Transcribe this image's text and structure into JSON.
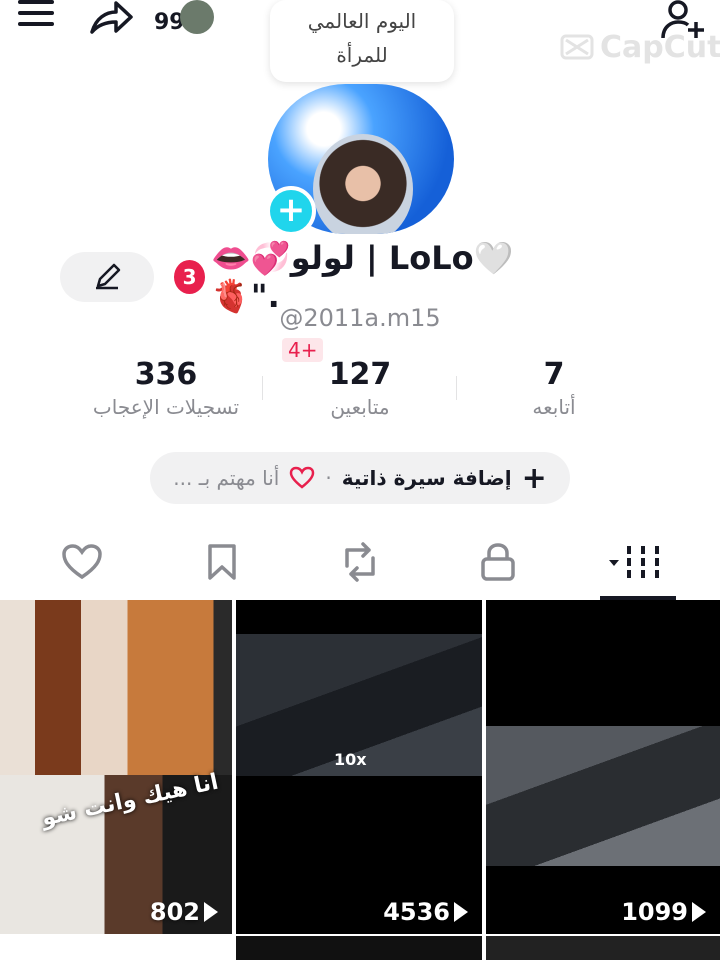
{
  "header": {
    "notification_count": "99",
    "watermark": "CapCut"
  },
  "event_bubble": {
    "line1": "اليوم العالمي",
    "line2": "للمرأة"
  },
  "profile": {
    "display_name": "👄💞لولو | LoLo🤍🫀\".",
    "notification_badge": "3",
    "username": "@2011a.m15",
    "new_badge": "4+"
  },
  "stats": [
    {
      "value": "7",
      "label": "أتابعه"
    },
    {
      "value": "127",
      "label": "متابعين"
    },
    {
      "value": "336",
      "label": "تسجيلات الإعجاب"
    }
  ],
  "bio_button": {
    "add_label": "إضافة سيرة ذاتية",
    "separator": "·",
    "interest_label": "أنا مهتم بـ ..."
  },
  "tabs": [
    "videos",
    "private",
    "reposts",
    "favorites",
    "liked"
  ],
  "videos": [
    {
      "views": "802",
      "caption": "انا هيك وانت شو"
    },
    {
      "views": "4536",
      "multiplier": "10x"
    },
    {
      "views": "1099"
    }
  ],
  "colors": {
    "accent": "#20d5ec",
    "badge": "#e8204d"
  }
}
